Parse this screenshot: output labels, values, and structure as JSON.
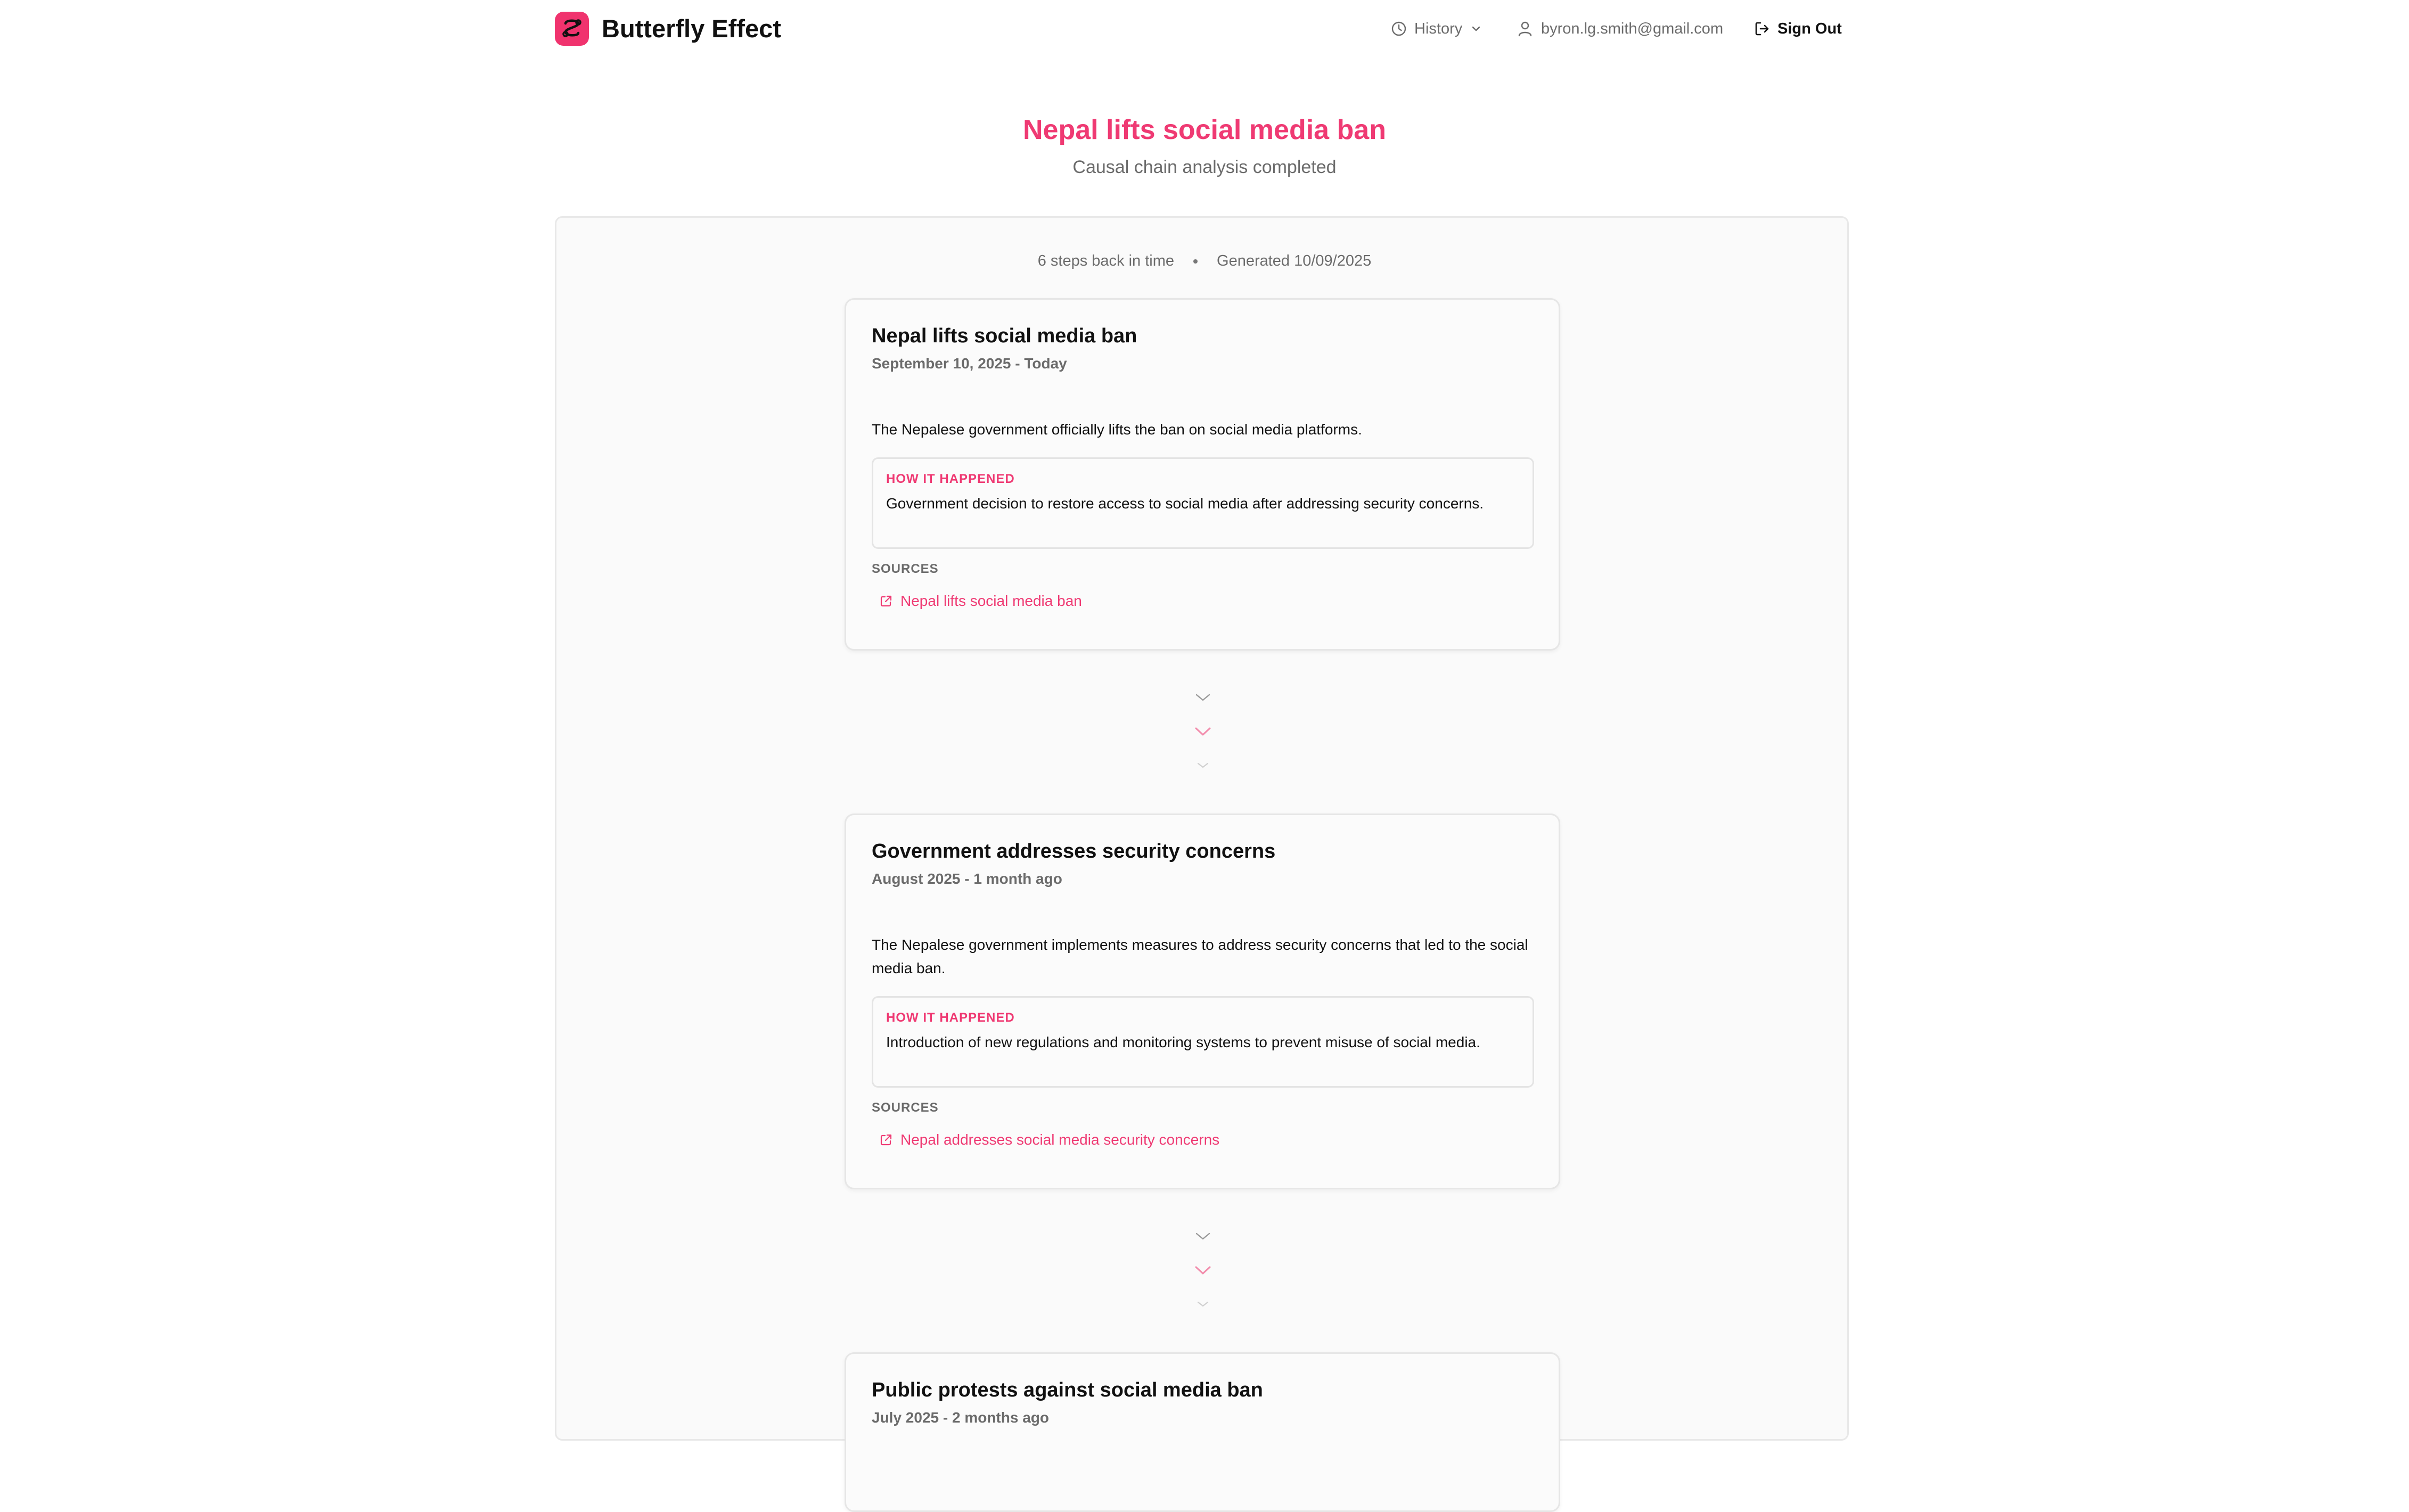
{
  "header": {
    "brand": "Butterfly Effect",
    "history_label": "History",
    "user_email": "byron.lg.smith@gmail.com",
    "signout_label": "Sign Out"
  },
  "hero": {
    "title": "Nepal lifts social media ban",
    "subtitle": "Causal chain analysis completed"
  },
  "meta": {
    "steps": "6 steps back in time",
    "generated": "Generated 10/09/2025"
  },
  "labels": {
    "how": "HOW IT HAPPENED",
    "sources": "SOURCES"
  },
  "events": [
    {
      "title": "Nepal lifts social media ban",
      "date": "September 10, 2025 - Today",
      "description": "The Nepalese government officially lifts the ban on social media platforms.",
      "how": "Government decision to restore access to social media after addressing security concerns.",
      "source": "Nepal lifts social media ban"
    },
    {
      "title": "Government addresses security concerns",
      "date": "August 2025 - 1 month ago",
      "description": "The Nepalese government implements measures to address security concerns that led to the social media ban.",
      "how": "Introduction of new regulations and monitoring systems to prevent misuse of social media.",
      "source": "Nepal addresses social media security concerns"
    },
    {
      "title": "Public protests against social media ban",
      "date": "July 2025 - 2 months ago"
    }
  ],
  "colors": {
    "accent": "#ef3a73",
    "muted_text": "#6b6b6b",
    "panel_bg": "#fafafa",
    "border": "#e6e6e6"
  },
  "icons": {
    "logo": "butterfly-logo-icon",
    "history": "clock-icon",
    "dropdown": "chevron-down-icon",
    "user": "user-icon",
    "signout": "sign-out-icon",
    "link": "external-link-icon",
    "connector": "chevron-down-icon"
  }
}
